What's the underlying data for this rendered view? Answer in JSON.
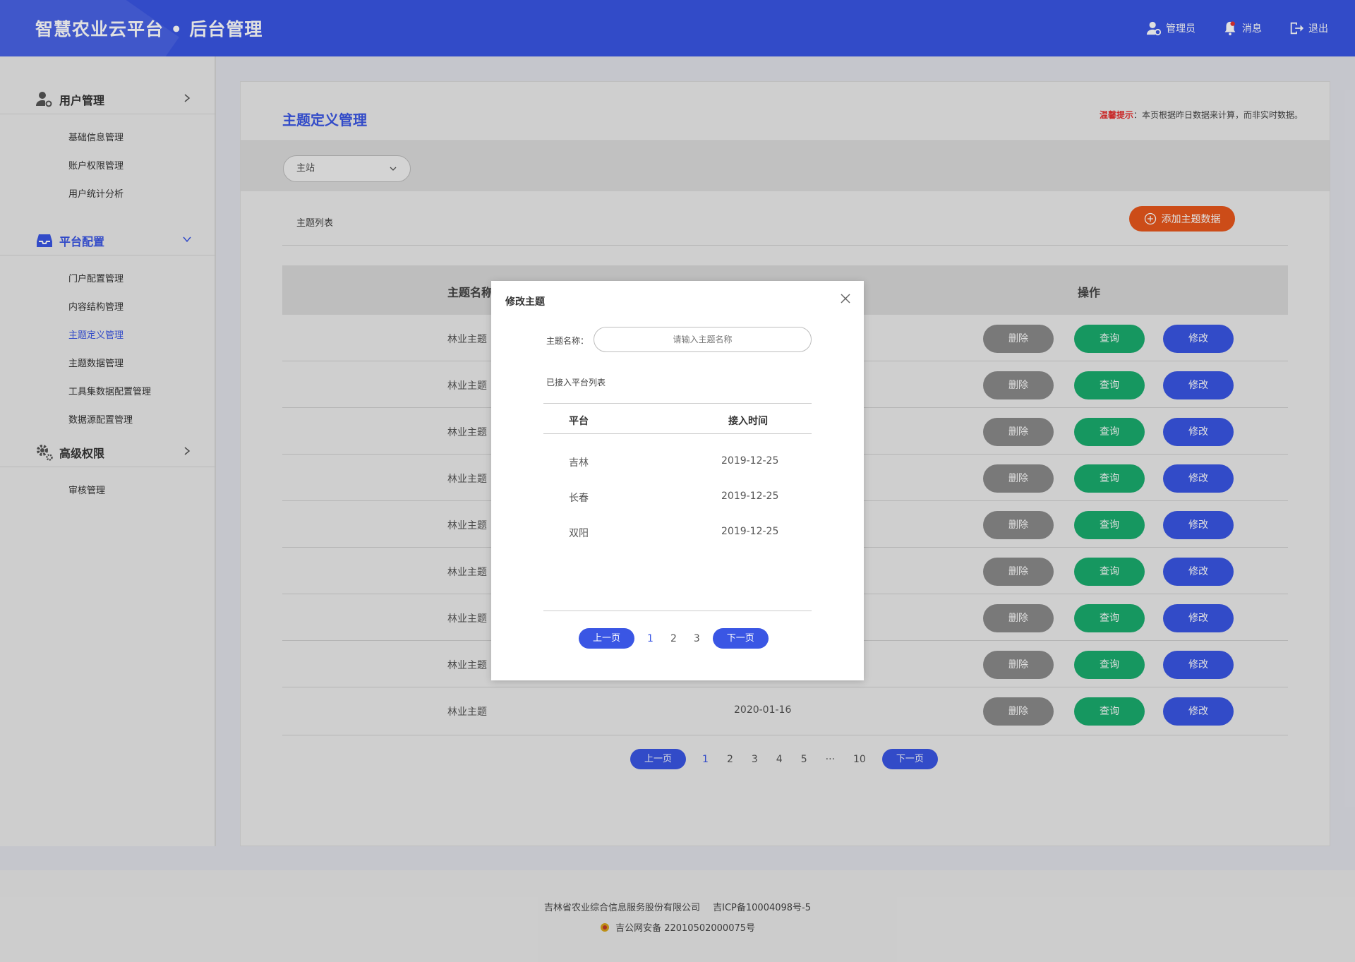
{
  "header": {
    "title": "智慧农业云平台 • 后台管理",
    "nav": [
      {
        "label": "管理员",
        "icon": "user-admin-icon"
      },
      {
        "label": "消息",
        "icon": "bell-icon"
      },
      {
        "label": "退出",
        "icon": "logout-icon"
      }
    ]
  },
  "sidebar": {
    "groups": [
      {
        "label": "用户管理",
        "icon": "user-gear-icon",
        "expanded": false,
        "items": [
          "基础信息管理",
          "账户权限管理",
          "用户统计分析"
        ]
      },
      {
        "label": "平台配置",
        "icon": "inbox-icon",
        "expanded": true,
        "items": [
          "门户配置管理",
          "内容结构管理",
          "主题定义管理",
          "主题数据管理",
          "工具集数据配置管理",
          "数据源配置管理"
        ]
      },
      {
        "label": "高级权限",
        "icon": "gears-icon",
        "expanded": false,
        "items": [
          "审核管理"
        ]
      }
    ],
    "active_item": "主题定义管理"
  },
  "main": {
    "page_title": "主题定义管理",
    "tip_label": "温馨提示",
    "tip_text": "：本页根据昨日数据来计算，而非实时数据。",
    "select_value": "主站",
    "list_label": "主题列表",
    "add_button": "添加主题数据",
    "table": {
      "headers": {
        "name": "主题名称",
        "action": "操作"
      },
      "rows": [
        {
          "name": "林业主题",
          "date": ""
        },
        {
          "name": "林业主题",
          "date": ""
        },
        {
          "name": "林业主题",
          "date": ""
        },
        {
          "name": "林业主题",
          "date": ""
        },
        {
          "name": "林业主题",
          "date": ""
        },
        {
          "name": "林业主题",
          "date": ""
        },
        {
          "name": "林业主题",
          "date": ""
        },
        {
          "name": "林业主题",
          "date": ""
        },
        {
          "name": "林业主题",
          "date": "2020-01-16"
        }
      ],
      "actions": {
        "delete": "删除",
        "query": "查询",
        "edit": "修改"
      }
    },
    "pager": {
      "prev": "上一页",
      "next": "下一页",
      "pages": [
        "1",
        "2",
        "3",
        "4",
        "5",
        "···",
        "10"
      ],
      "current": "1"
    }
  },
  "modal": {
    "title": "修改主题",
    "field_label": "主题名称：",
    "field_placeholder": "请输入主题名称",
    "sub_title": "已接入平台列表",
    "columns": {
      "platform": "平台",
      "time": "接入时间"
    },
    "rows": [
      {
        "platform": "吉林",
        "time": "2019-12-25"
      },
      {
        "platform": "长春",
        "time": "2019-12-25"
      },
      {
        "platform": "双阳",
        "time": "2019-12-25"
      }
    ],
    "pager": {
      "prev": "上一页",
      "next": "下一页",
      "pages": [
        "1",
        "2",
        "3"
      ],
      "current": "1"
    }
  },
  "footer": {
    "company": "吉林省农业综合信息服务股份有限公司",
    "icp": "吉ICP备10004098号-5",
    "police": "吉公网安备 22010502000075号"
  },
  "colors": {
    "primary": "#3a56e4",
    "orange": "#e9571c",
    "green": "#1aac6e",
    "gray": "#8a8a8a",
    "warn": "#e53333"
  }
}
